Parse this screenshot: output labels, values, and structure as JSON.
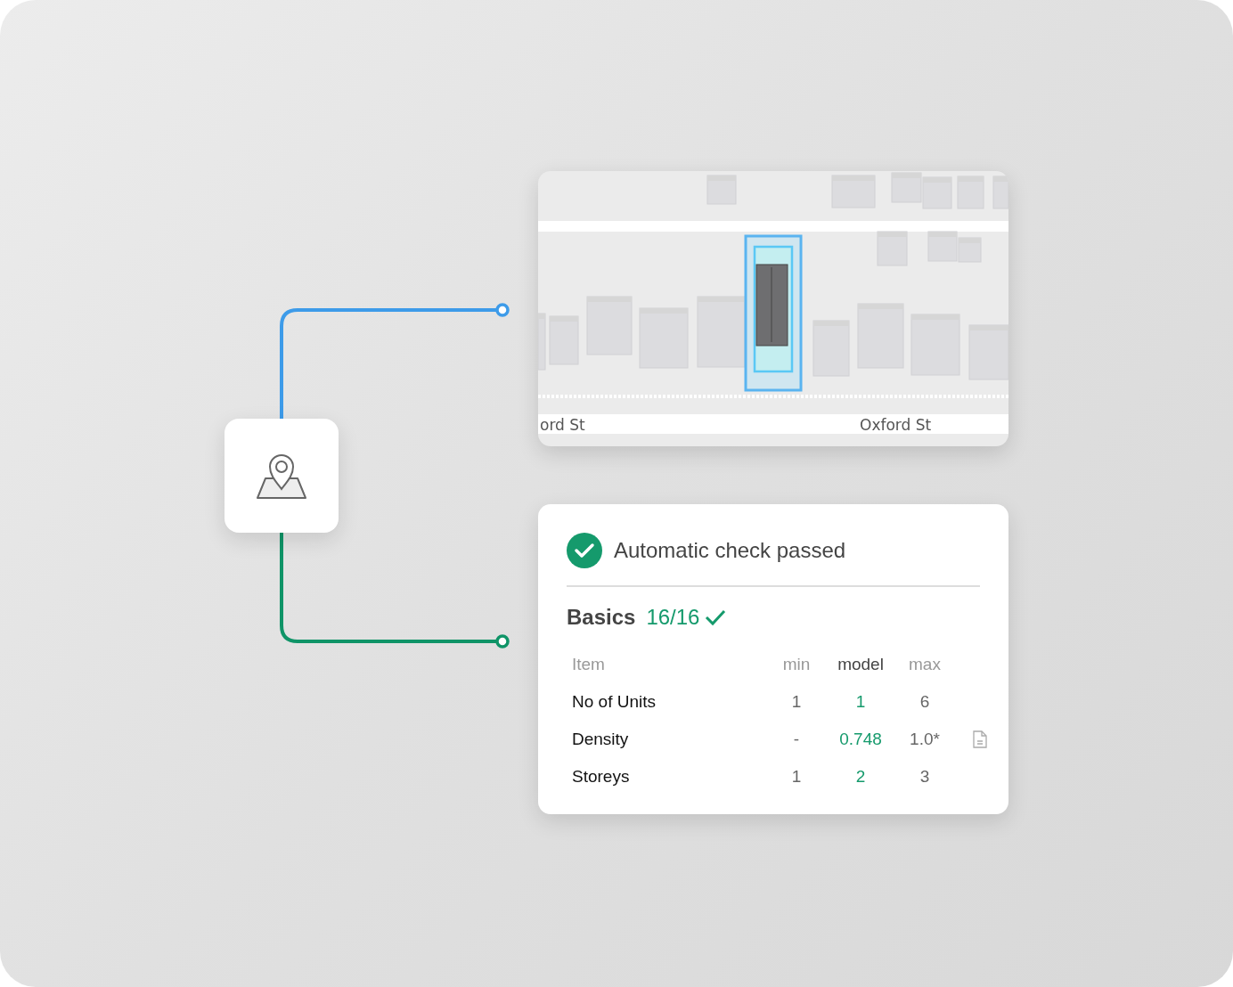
{
  "map": {
    "street_labels": [
      "ord St",
      "Oxford St"
    ]
  },
  "check": {
    "status": "Automatic check passed",
    "passed": true,
    "section": {
      "title": "Basics",
      "score": "16/16",
      "passed": true
    },
    "columns": [
      "Item",
      "min",
      "model",
      "max"
    ],
    "rows": [
      {
        "item": "No of Units",
        "min": "1",
        "model": "1",
        "max": "6",
        "note": false
      },
      {
        "item": "Density",
        "min": "-",
        "model": "0.748",
        "max": "1.0*",
        "note": true
      },
      {
        "item": "Storeys",
        "min": "1",
        "model": "2",
        "max": "3",
        "note": false
      }
    ]
  }
}
